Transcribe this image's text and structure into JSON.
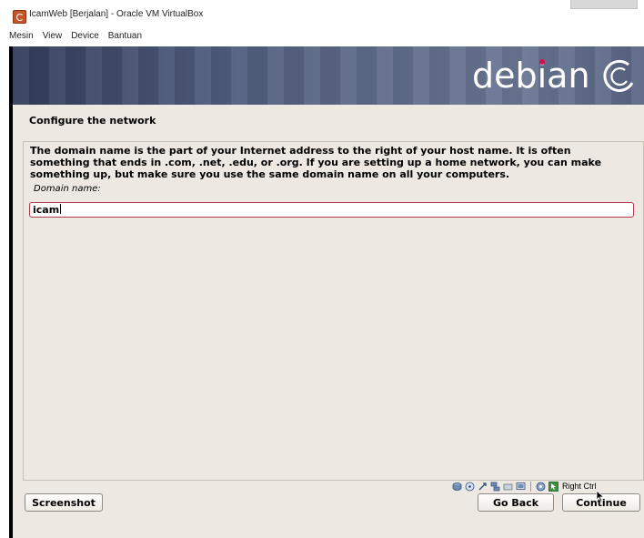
{
  "window": {
    "title": "IcamWeb [Berjalan] - Oracle VM VirtualBox",
    "menu": [
      "Mesin",
      "View",
      "Device",
      "Bantuan"
    ]
  },
  "installer": {
    "logo_text": "debian",
    "section_title": "Configure the network",
    "description": "The domain name is the part of your Internet address to the right of your host name.  It is often something that ends in .com, .net, .edu, or .org.  If you are setting up a home network, you can make something up, but make sure you use the same domain name on all your computers.",
    "field_label": "Domain name:",
    "domain_value": "icam",
    "buttons": {
      "screenshot": "Screenshot",
      "go_back": "Go Back",
      "continue": "Continue"
    }
  },
  "statusbar": {
    "icons": [
      "hard-disk-icon",
      "optical-drive-icon",
      "usb-icon",
      "network-icon",
      "shared-folders-icon",
      "display-icon",
      "video-capture-icon",
      "mouse-integration-icon"
    ],
    "host_key": "Right Ctrl"
  },
  "colors": {
    "banner": "#4d5a7b",
    "background": "#ede9e2",
    "input_border": "#b03a4a",
    "debian_red": "#d70a53"
  }
}
